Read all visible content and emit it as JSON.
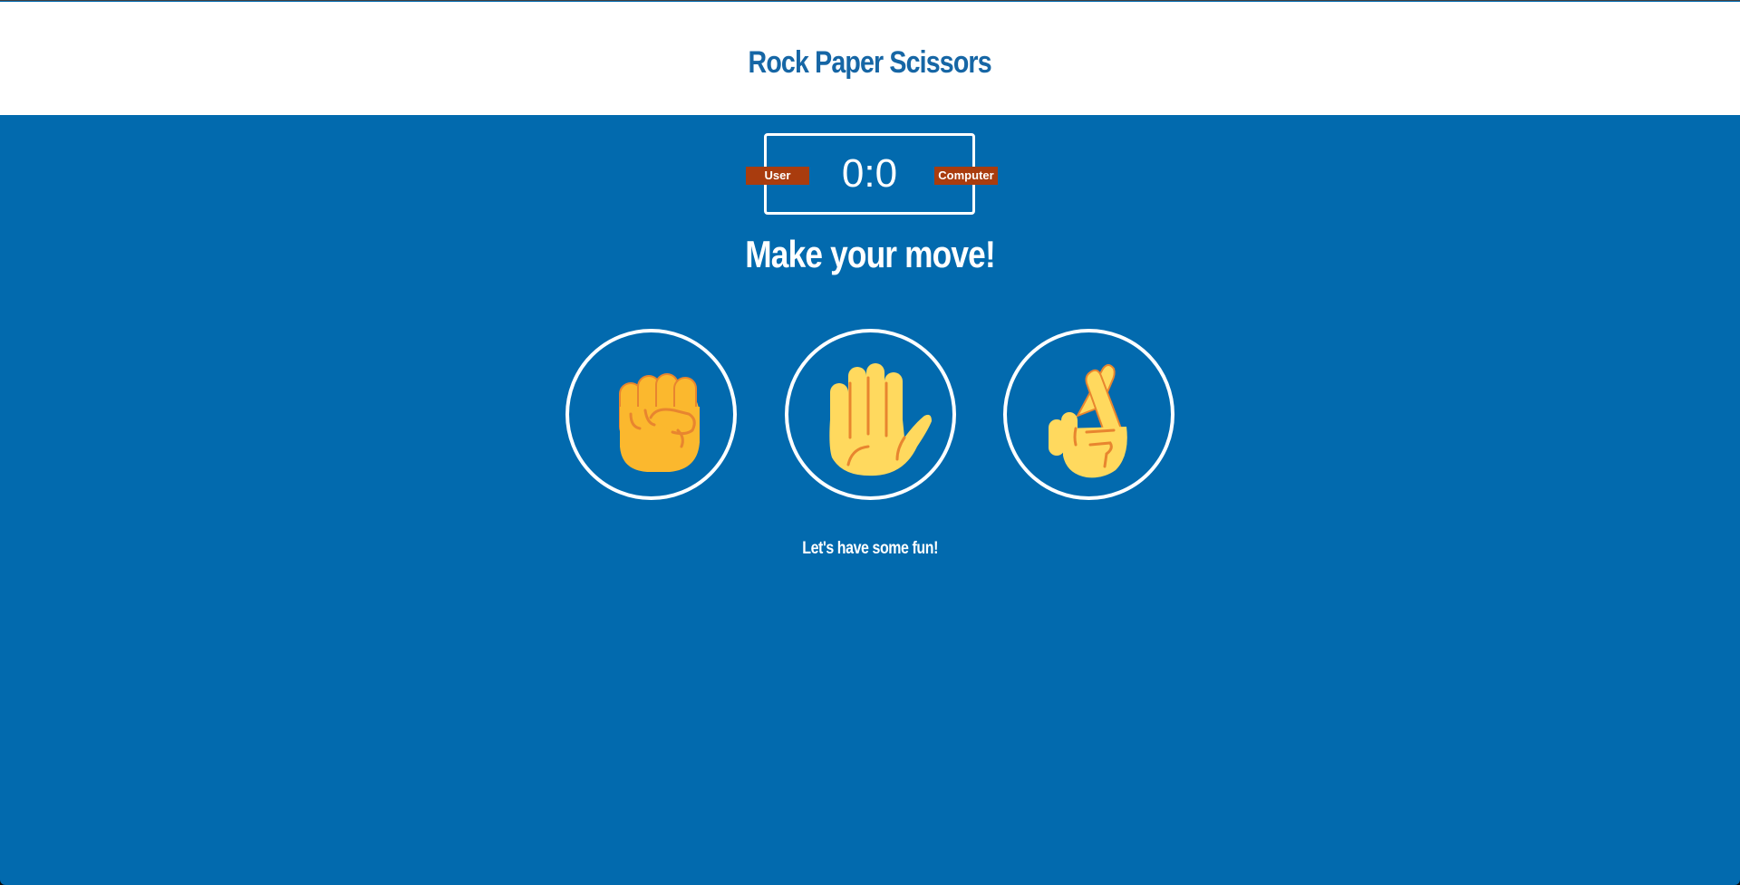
{
  "header": {
    "title": "Rock Paper Scissors"
  },
  "scoreboard": {
    "user_label": "User",
    "computer_label": "Computer",
    "score": "0:0"
  },
  "prompt": "Make your move!",
  "choices": [
    {
      "name": "rock",
      "icon": "raised-fist-icon"
    },
    {
      "name": "paper",
      "icon": "raised-hand-icon"
    },
    {
      "name": "scissors",
      "icon": "crossed-fingers-icon"
    }
  ],
  "message": "Let's have some fun!",
  "colors": {
    "background": "#026aae",
    "header_background": "#ffffff",
    "title_color": "#1666a5",
    "badge": "#a93c0e",
    "hand_primary": "#fbb82e",
    "hand_light": "#ffd95e",
    "hand_line": "#e8852f"
  }
}
